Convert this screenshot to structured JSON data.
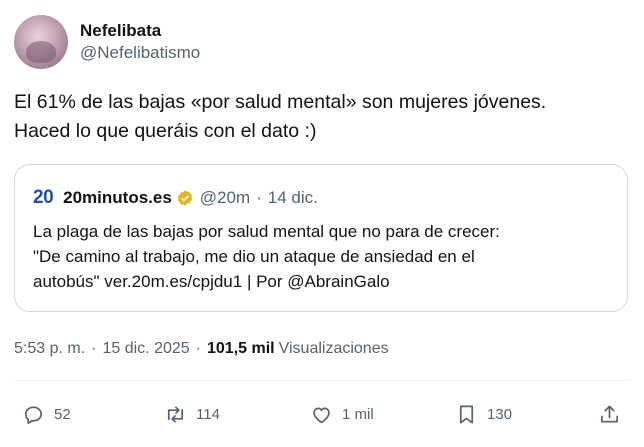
{
  "author": {
    "display_name": "Nefelibata",
    "handle": "@Nefelibatismo"
  },
  "tweet_text": {
    "line1": "El 61% de las bajas «por salud mental» son mujeres jóvenes.",
    "line2": "Haced lo que queráis con el dato :)"
  },
  "quoted": {
    "logo_text": "20",
    "name": "20minutos.es",
    "handle": "@20m",
    "separator": "·",
    "date": "14 dic.",
    "badge_color": "#e2b719",
    "line1": "La plaga de las bajas por salud mental que no para de crecer:",
    "line2": "\"De camino al trabajo, me dio un ataque de ansiedad en el",
    "line3": "autobús\" ver.20m.es/cpjdu1 | Por @AbrainGalo"
  },
  "meta": {
    "time": "5:53 p. m.",
    "separator": "·",
    "date": "15 dic. 2025",
    "views_count": "101,5 mil",
    "views_label": "Visualizaciones"
  },
  "actions": {
    "replies": "52",
    "retweets": "114",
    "likes": "1 mil",
    "bookmarks": "130"
  },
  "colors": {
    "text": "#0f1419",
    "secondary": "#536471",
    "border": "#cfd9de",
    "logo": "#1f4fa8"
  }
}
